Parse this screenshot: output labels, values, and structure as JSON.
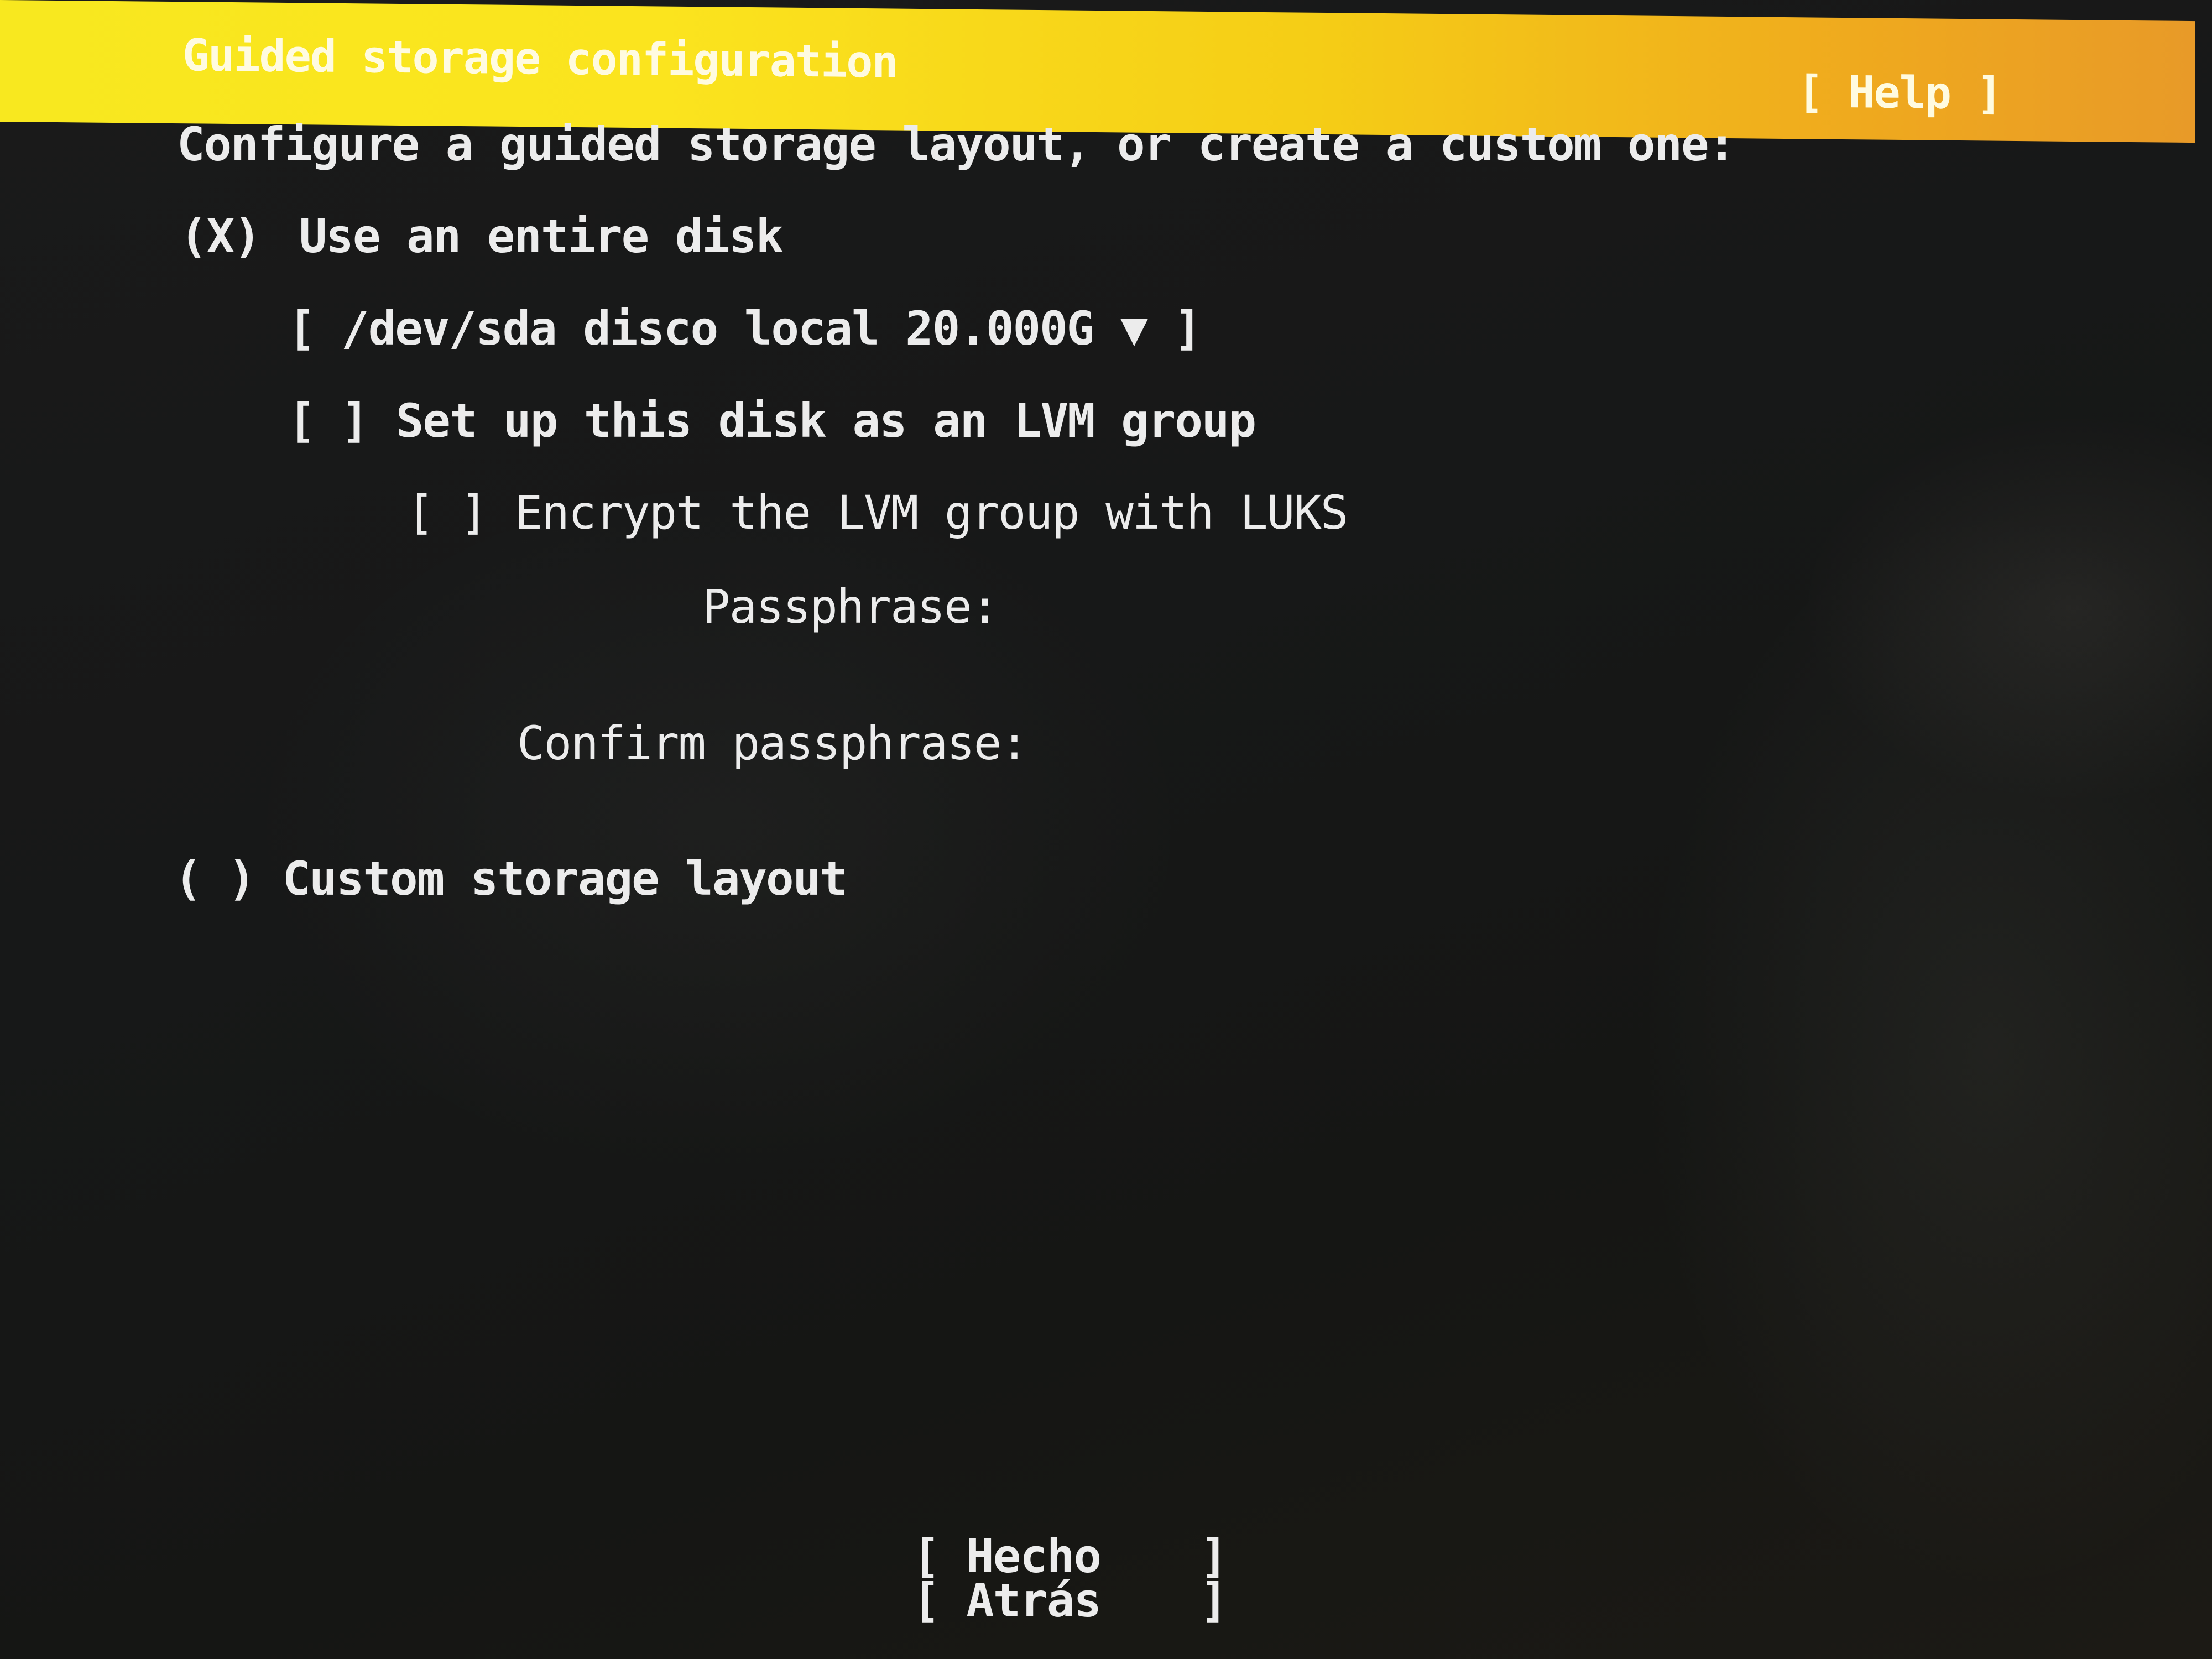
{
  "header": {
    "title": "Guided storage configuration",
    "help_label": "[ Help ]",
    "background_color": "#f8e81f"
  },
  "form": {
    "intro": "Configure a guided storage layout, or create a custom one:",
    "entire_disk": {
      "marker": "(X)",
      "label": "Use an entire disk",
      "selected": true
    },
    "disk_select": {
      "open_bracket": "[",
      "value": "/dev/sda disco local 20.000G",
      "arrow": "▼",
      "close_bracket": "]"
    },
    "lvm": {
      "marker": "[ ]",
      "label": "Set up this disk as an LVM group",
      "checked": false
    },
    "luks": {
      "marker": "[ ]",
      "label": "Encrypt the LVM group with LUKS",
      "checked": false
    },
    "passphrase_label": "Passphrase:",
    "confirm_label": "Confirm passphrase:",
    "custom_layout": {
      "marker": "( )",
      "label": "Custom storage layout",
      "selected": false
    }
  },
  "buttons": {
    "done": {
      "open": "[",
      "label": "Hecho",
      "close": "]"
    },
    "back": {
      "open": "[",
      "label": "Atrás",
      "close": "]"
    }
  },
  "colors": {
    "text": "#ececec",
    "background": "#161716"
  }
}
